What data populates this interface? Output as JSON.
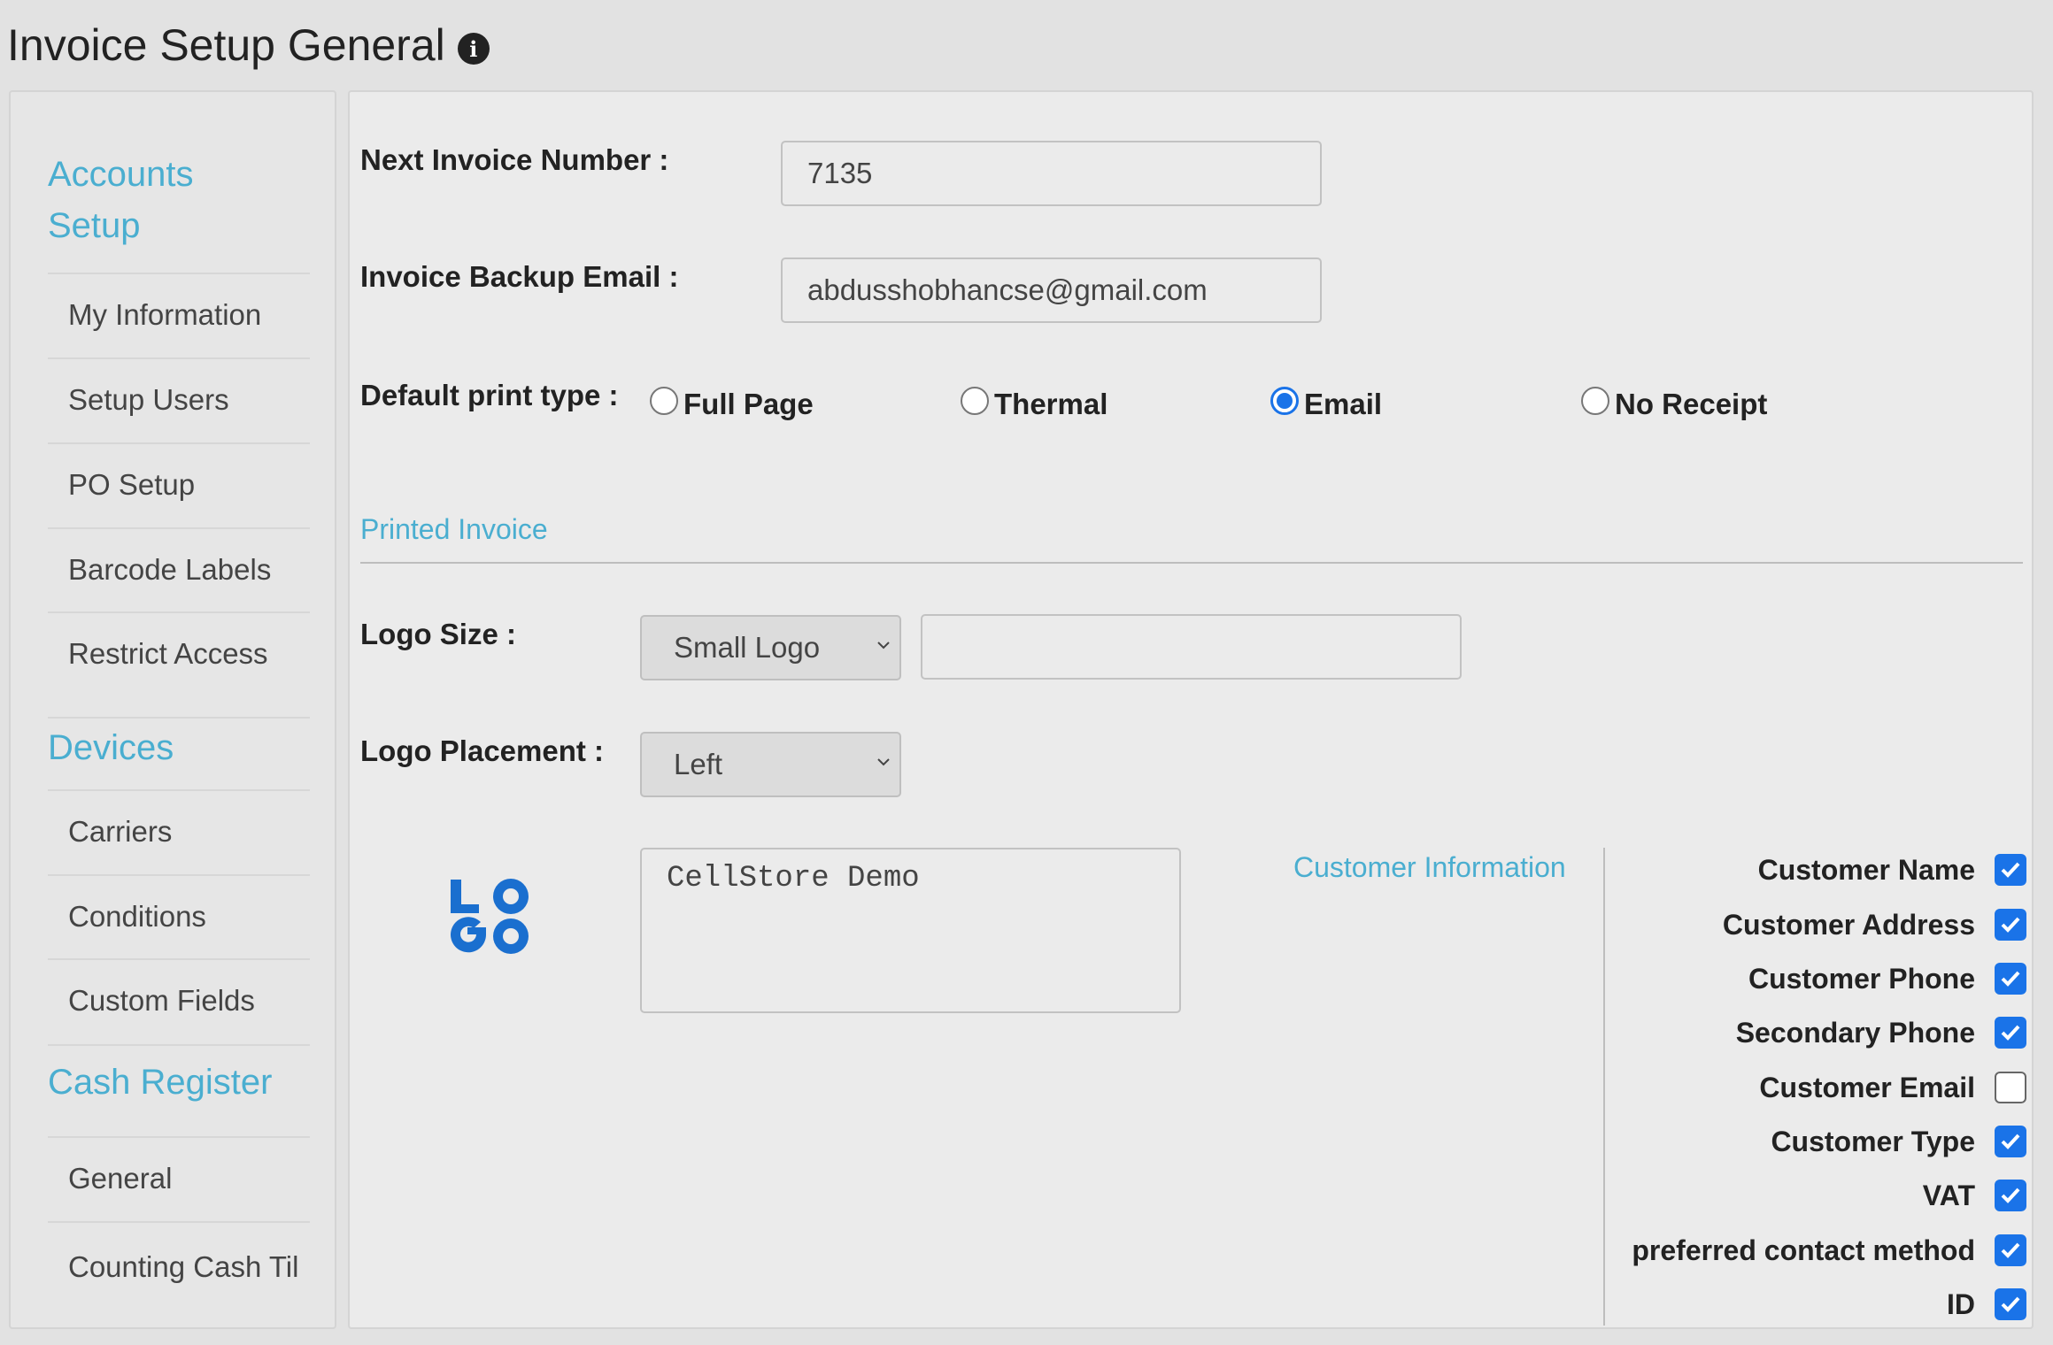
{
  "page": {
    "title": "Invoice Setup General"
  },
  "sidebar": {
    "sections": [
      {
        "title": "Accounts Setup",
        "items": [
          "My Information",
          "Setup Users",
          "PO Setup",
          "Barcode Labels",
          "Restrict Access"
        ]
      },
      {
        "title": "Devices",
        "items": [
          "Carriers",
          "Conditions",
          "Custom Fields"
        ]
      },
      {
        "title": "Cash Register",
        "items": [
          "General",
          "Counting Cash Til"
        ]
      }
    ]
  },
  "form": {
    "next_invoice_label": "Next Invoice Number :",
    "next_invoice_value": "7135",
    "backup_email_label": "Invoice Backup Email :",
    "backup_email_value": "abdusshobhancse@gmail.com",
    "print_type_label": "Default print type :",
    "print_types": [
      {
        "label": "Full Page",
        "checked": false
      },
      {
        "label": "Thermal",
        "checked": false
      },
      {
        "label": "Email",
        "checked": true
      },
      {
        "label": "No Receipt",
        "checked": false
      }
    ]
  },
  "printed_invoice": {
    "section_title": "Printed Invoice",
    "logo_size_label": "Logo Size :",
    "logo_size_value": "Small Logo",
    "logo_size_text": "",
    "logo_placement_label": "Logo Placement :",
    "logo_placement_value": "Left",
    "logo_text": "LOGO",
    "header_text": "CellStore Demo",
    "customer_info_title": "Customer Information",
    "customer_fields": [
      {
        "label": "Customer Name",
        "checked": true
      },
      {
        "label": "Customer Address",
        "checked": true
      },
      {
        "label": "Customer Phone",
        "checked": true
      },
      {
        "label": "Secondary Phone",
        "checked": true
      },
      {
        "label": "Customer Email",
        "checked": false
      },
      {
        "label": "Customer Type",
        "checked": true
      },
      {
        "label": "VAT",
        "checked": true
      },
      {
        "label": "preferred contact method",
        "checked": true
      },
      {
        "label": "ID",
        "checked": true
      }
    ]
  },
  "colors": {
    "accent": "#4aaed0",
    "checkbox_on": "#1a73e8",
    "logo_blue": "#1a6fcf"
  }
}
